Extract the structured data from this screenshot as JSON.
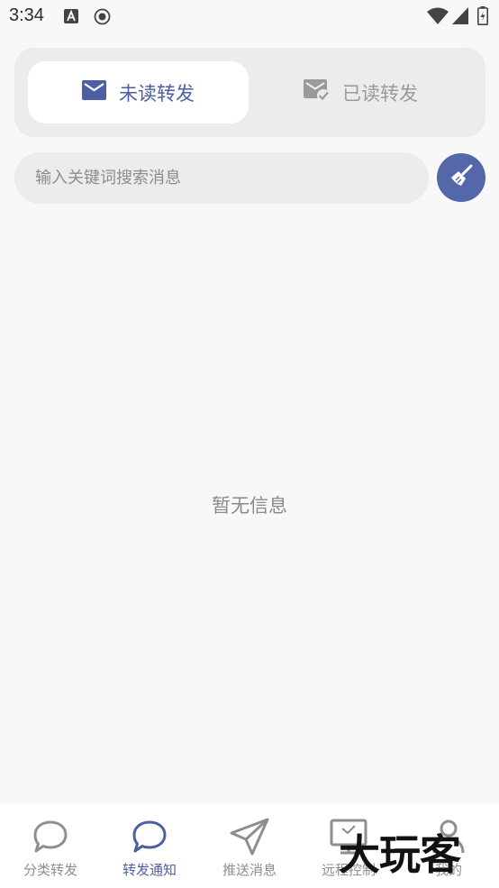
{
  "status_bar": {
    "time": "3:34",
    "icons": [
      "a-notification-icon",
      "chat-notification-icon",
      "wifi-icon",
      "signal-icon",
      "battery-icon"
    ]
  },
  "tabs": [
    {
      "label": "未读转发",
      "icon": "mail-icon",
      "active": true
    },
    {
      "label": "已读转发",
      "icon": "mail-check-icon",
      "active": false
    }
  ],
  "search": {
    "placeholder": "输入关键词搜索消息",
    "value": ""
  },
  "clear_button": {
    "icon": "broom-icon"
  },
  "empty_state": {
    "text": "暂无信息"
  },
  "bottom_nav": [
    {
      "label": "分类转发",
      "icon": "chat-bubble-icon",
      "active": false
    },
    {
      "label": "转发通知",
      "icon": "chat-bubble-icon",
      "active": true
    },
    {
      "label": "推送消息",
      "icon": "send-icon",
      "active": false
    },
    {
      "label": "远程控制",
      "icon": "monitor-icon",
      "active": false
    },
    {
      "label": "我的",
      "icon": "person-icon",
      "active": false
    }
  ],
  "watermark": {
    "text": "大玩客"
  },
  "colors": {
    "accent": "#4d5fa3",
    "button": "#5367aa",
    "inactive": "#9a9a9a",
    "background": "#f8f8f8"
  }
}
